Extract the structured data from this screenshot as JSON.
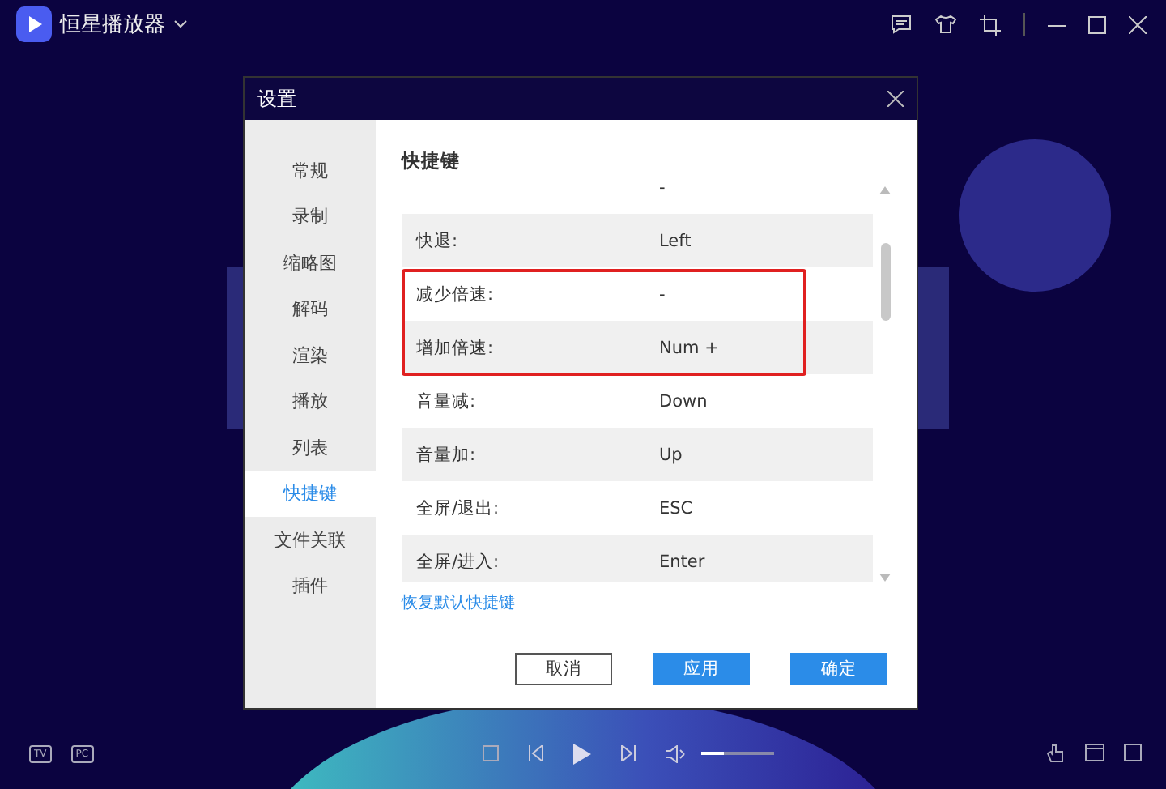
{
  "app": {
    "title": "恒星播放器"
  },
  "dialog": {
    "title": "设置",
    "sidebar": [
      {
        "label": "常规",
        "selected": false
      },
      {
        "label": "录制",
        "selected": false
      },
      {
        "label": "缩略图",
        "selected": false
      },
      {
        "label": "解码",
        "selected": false
      },
      {
        "label": "渲染",
        "selected": false
      },
      {
        "label": "播放",
        "selected": false
      },
      {
        "label": "列表",
        "selected": false
      },
      {
        "label": "快捷键",
        "selected": true
      },
      {
        "label": "文件关联",
        "selected": false
      },
      {
        "label": "插件",
        "selected": false
      }
    ],
    "heading": "快捷键",
    "shortcuts": [
      {
        "key": "-",
        "highlighted": false
      },
      {
        "action": "快退:",
        "key": "Left",
        "highlighted": false
      },
      {
        "action": "减少倍速:",
        "key": "-",
        "highlighted": true
      },
      {
        "action": "增加倍速:",
        "key": "Num +",
        "highlighted": true
      },
      {
        "action": "音量减:",
        "key": "Down",
        "highlighted": false
      },
      {
        "action": "音量加:",
        "key": "Up",
        "highlighted": false
      },
      {
        "action": "全屏/退出:",
        "key": "ESC",
        "highlighted": false
      },
      {
        "action": "全屏/进入:",
        "key": "Enter",
        "highlighted": false
      }
    ],
    "reset_link": "恢复默认快捷键",
    "buttons": [
      {
        "label": "取消",
        "kind": "secondary"
      },
      {
        "label": "应用",
        "kind": "primary"
      },
      {
        "label": "确定",
        "kind": "primary"
      }
    ]
  },
  "player": {
    "left_icons": [
      "TV",
      "PC"
    ],
    "volume": {
      "level": 0.3
    }
  }
}
